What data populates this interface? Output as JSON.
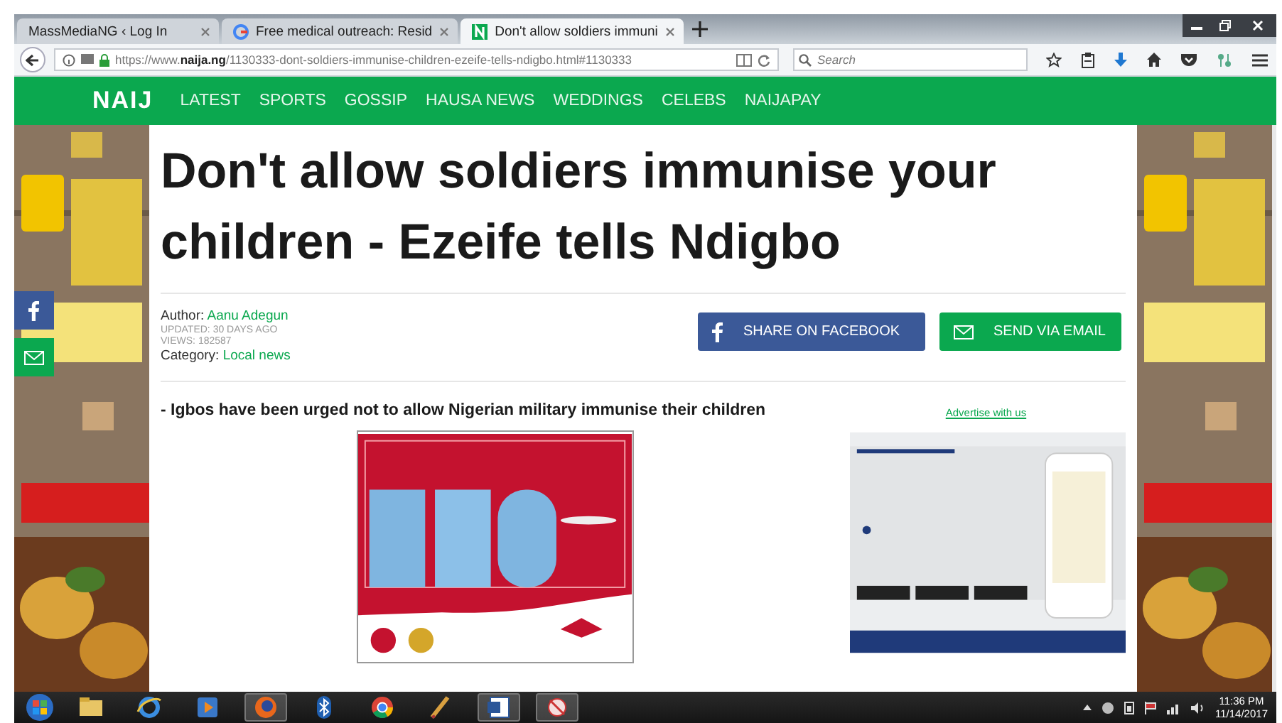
{
  "browser": {
    "tabs": [
      {
        "title": "MassMediaNG ‹ Log In",
        "kind": "plain",
        "selected": false
      },
      {
        "title": "Free medical outreach: Resid",
        "kind": "google",
        "selected": false
      },
      {
        "title": "Don't allow soldiers immuni",
        "kind": "naija",
        "selected": true
      }
    ],
    "url": "https://www.**naija.ng**/1130333-dont-soldiers-immunise-children-ezeife-tells-ndigbo.html#1130333",
    "search": {
      "placeholder": "Search"
    }
  },
  "site_nav": {
    "logo": "NAIJ",
    "items": [
      "LATEST",
      "SPORTS",
      "GOSSIP",
      "HAUSA NEWS",
      "WEDDINGS",
      "CELEBS",
      "NAIJAPAY"
    ]
  },
  "article": {
    "title": "Don't allow soldiers immunise your children - Ezeife tells Ndigbo",
    "author_label": "Author:",
    "author": "Aanu Adegun",
    "updated": "UPDATED: 30 DAYS AGO",
    "views": "VIEWS: 182587",
    "category_label": "Category:",
    "category": "Local news",
    "share_buttons": [
      {
        "kind": "facebook",
        "label": "SHARE ON FACEBOOK"
      },
      {
        "kind": "email",
        "label": "SEND VIA EMAIL"
      }
    ],
    "lead": "- Igbos have been urged not to allow Nigerian military immunise their children",
    "advertise_link": "Advertise with us"
  },
  "taskbar": {
    "apps": [
      {
        "kind": "folder",
        "active": false
      },
      {
        "kind": "ie",
        "active": false
      },
      {
        "kind": "media",
        "active": false
      },
      {
        "kind": "firefox",
        "active": true
      },
      {
        "kind": "bluetooth",
        "active": false
      },
      {
        "kind": "chrome",
        "active": false
      },
      {
        "kind": "tool",
        "active": false
      },
      {
        "kind": "word",
        "active": true
      },
      {
        "kind": "snip",
        "active": true
      }
    ],
    "time": "11:36 PM",
    "date": "11/14/2017"
  }
}
